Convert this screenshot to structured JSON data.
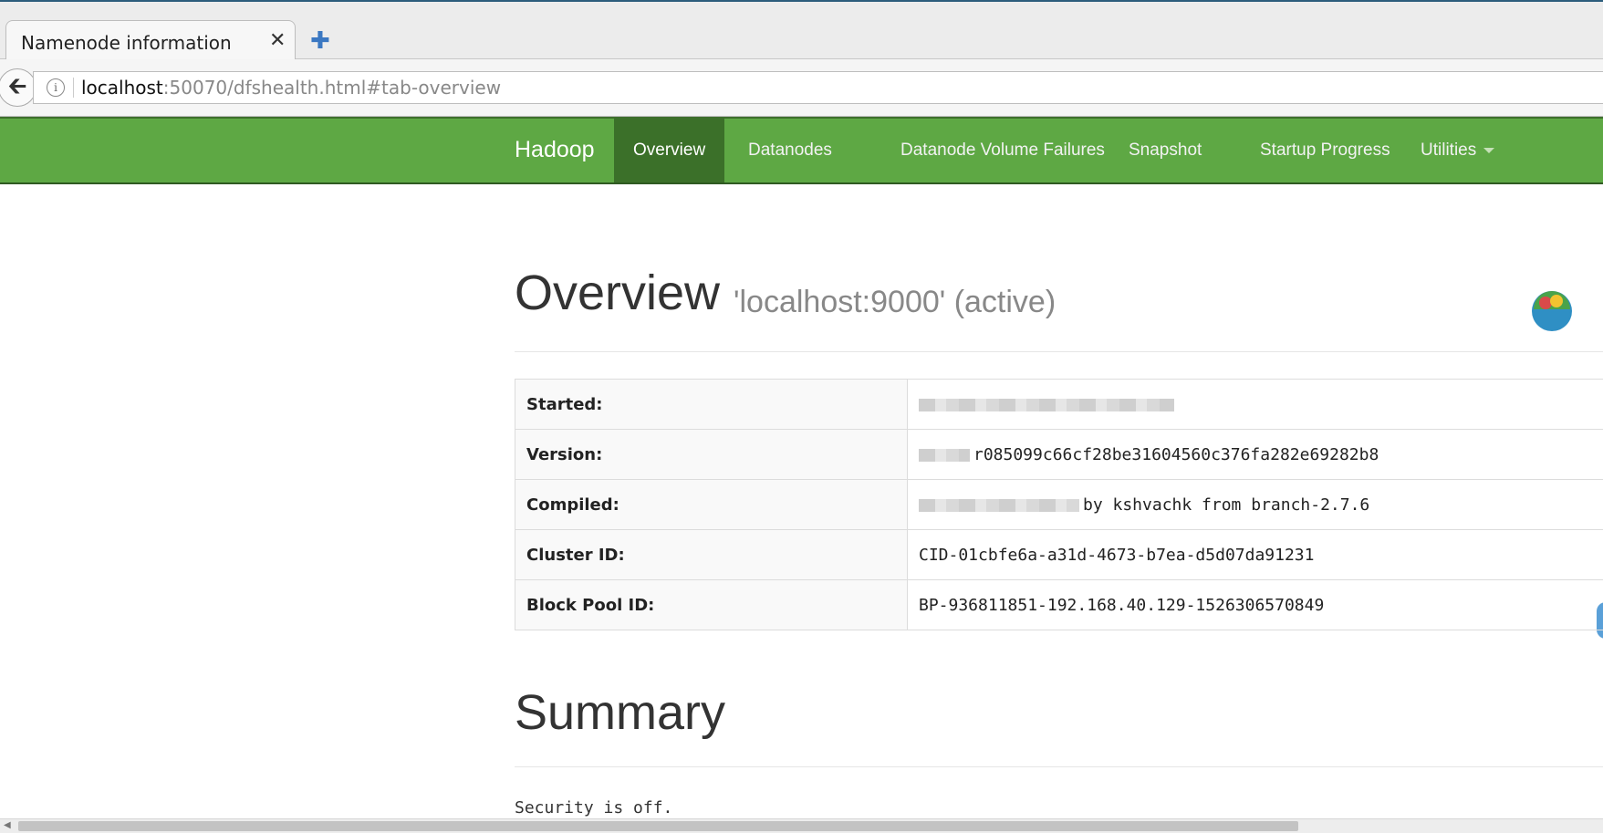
{
  "browser": {
    "tab_title": "Namenode information",
    "tab_close": "✕",
    "new_tab": "✚",
    "url_host": "localhost",
    "url_rest": ":50070/dfshealth.html#tab-overview"
  },
  "navbar": {
    "brand": "Hadoop",
    "items": [
      "Overview",
      "Datanodes",
      "Datanode Volume Failures",
      "Snapshot",
      "Startup Progress",
      "Utilities"
    ]
  },
  "overview": {
    "title": "Overview",
    "subtitle": "'localhost:9000' (active)",
    "rows": [
      {
        "key": "Started:",
        "value": ""
      },
      {
        "key": "Version:",
        "value": "r085099c66cf28be31604560c376fa282e69282b8"
      },
      {
        "key": "Compiled:",
        "value": "by kshvachk from branch-2.7.6"
      },
      {
        "key": "Cluster ID:",
        "value": "CID-01cbfe6a-a31d-4673-b7ea-d5d07da91231"
      },
      {
        "key": "Block Pool ID:",
        "value": "BP-936811851-192.168.40.129-1526306570849"
      }
    ]
  },
  "summary": {
    "title": "Summary",
    "security_text": "Security is off."
  },
  "icons": [
    "back-arrow-icon",
    "info-icon",
    "new-tab-icon",
    "close-icon",
    "extension-logo-icon"
  ],
  "colors": {
    "navbar": "#5ea844",
    "navbar_active": "#3b7029"
  }
}
